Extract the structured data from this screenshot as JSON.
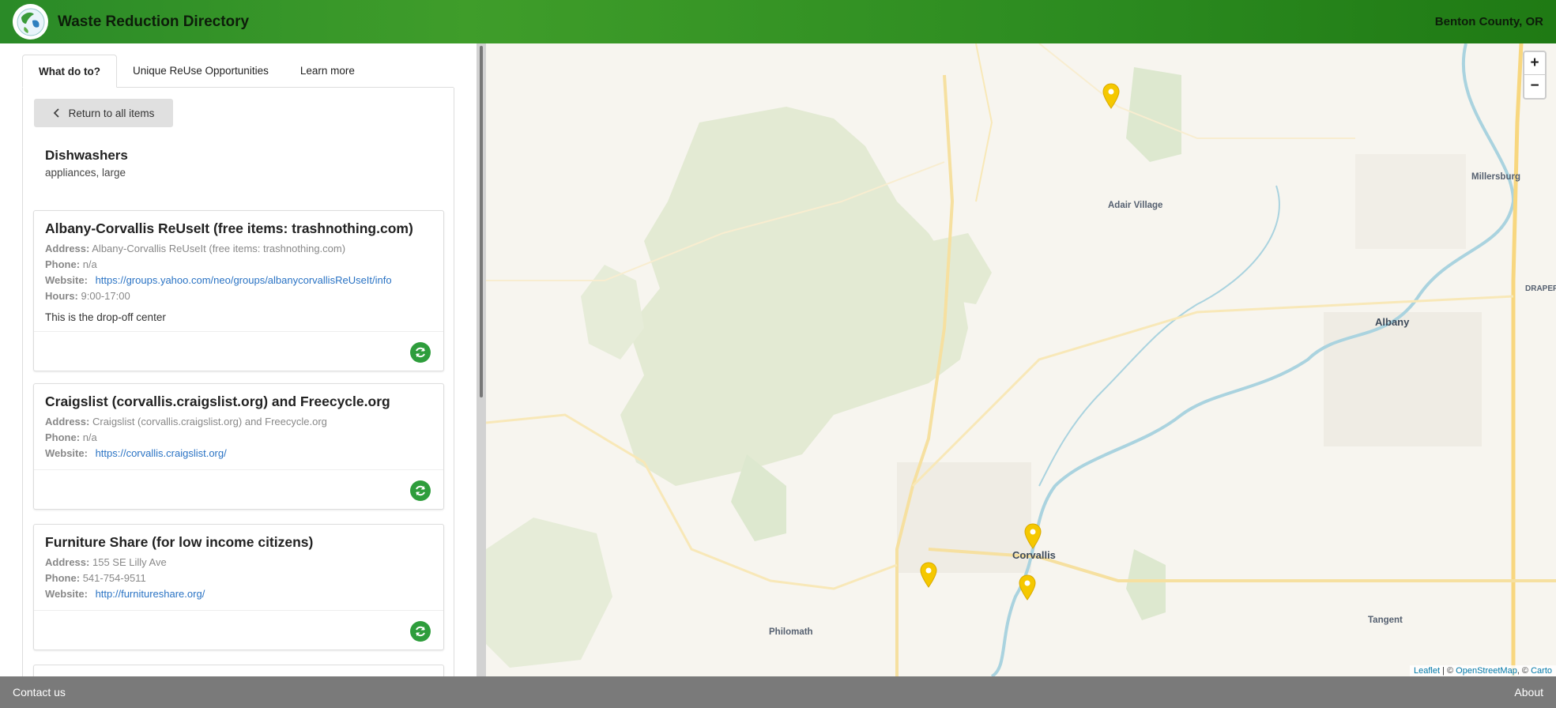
{
  "header": {
    "title": "Waste Reduction Directory",
    "region": "Benton County, OR"
  },
  "tabs": [
    {
      "label": "What do to?"
    },
    {
      "label": "Unique ReUse Opportunities"
    },
    {
      "label": "Learn more"
    }
  ],
  "back_label": "Return to all items",
  "item": {
    "title": "Dishwashers",
    "subtitle": "appliances, large"
  },
  "labels": {
    "address": "Address:",
    "phone": "Phone:",
    "website": "Website:",
    "hours": "Hours:"
  },
  "cards": [
    {
      "title": "Albany-Corvallis ReUseIt (free items: trashnothing.com)",
      "address": "Albany-Corvallis ReUseIt (free items: trashnothing.com)",
      "phone": "n/a",
      "website": "https://groups.yahoo.com/neo/groups/albanycorvallisReUseIt/info",
      "hours": "9:00-17:00",
      "note": "This is the drop-off center"
    },
    {
      "title": "Craigslist (corvallis.craigslist.org) and Freecycle.org",
      "address": "Craigslist (corvallis.craigslist.org) and Freecycle.org",
      "phone": "n/a",
      "website": "https://corvallis.craigslist.org/"
    },
    {
      "title": "Furniture Share (for low income citizens)",
      "address": "155 SE Lilly Ave",
      "phone": "541-754-9511",
      "website": "http://furnitureshare.org/"
    }
  ],
  "map": {
    "zoom_in": "+",
    "zoom_out": "−",
    "places": [
      "Adair Village",
      "Millersburg",
      "Albany",
      "Corvallis",
      "Philomath",
      "Tangent",
      "DRAPER"
    ],
    "attribution": {
      "leaflet": "Leaflet",
      "sep1": " | © ",
      "osm": "OpenStreetMap",
      "sep2": ", © ",
      "carto": "Carto"
    },
    "marker_color": "#f5c800"
  },
  "footer": {
    "contact": "Contact us",
    "about": "About"
  }
}
